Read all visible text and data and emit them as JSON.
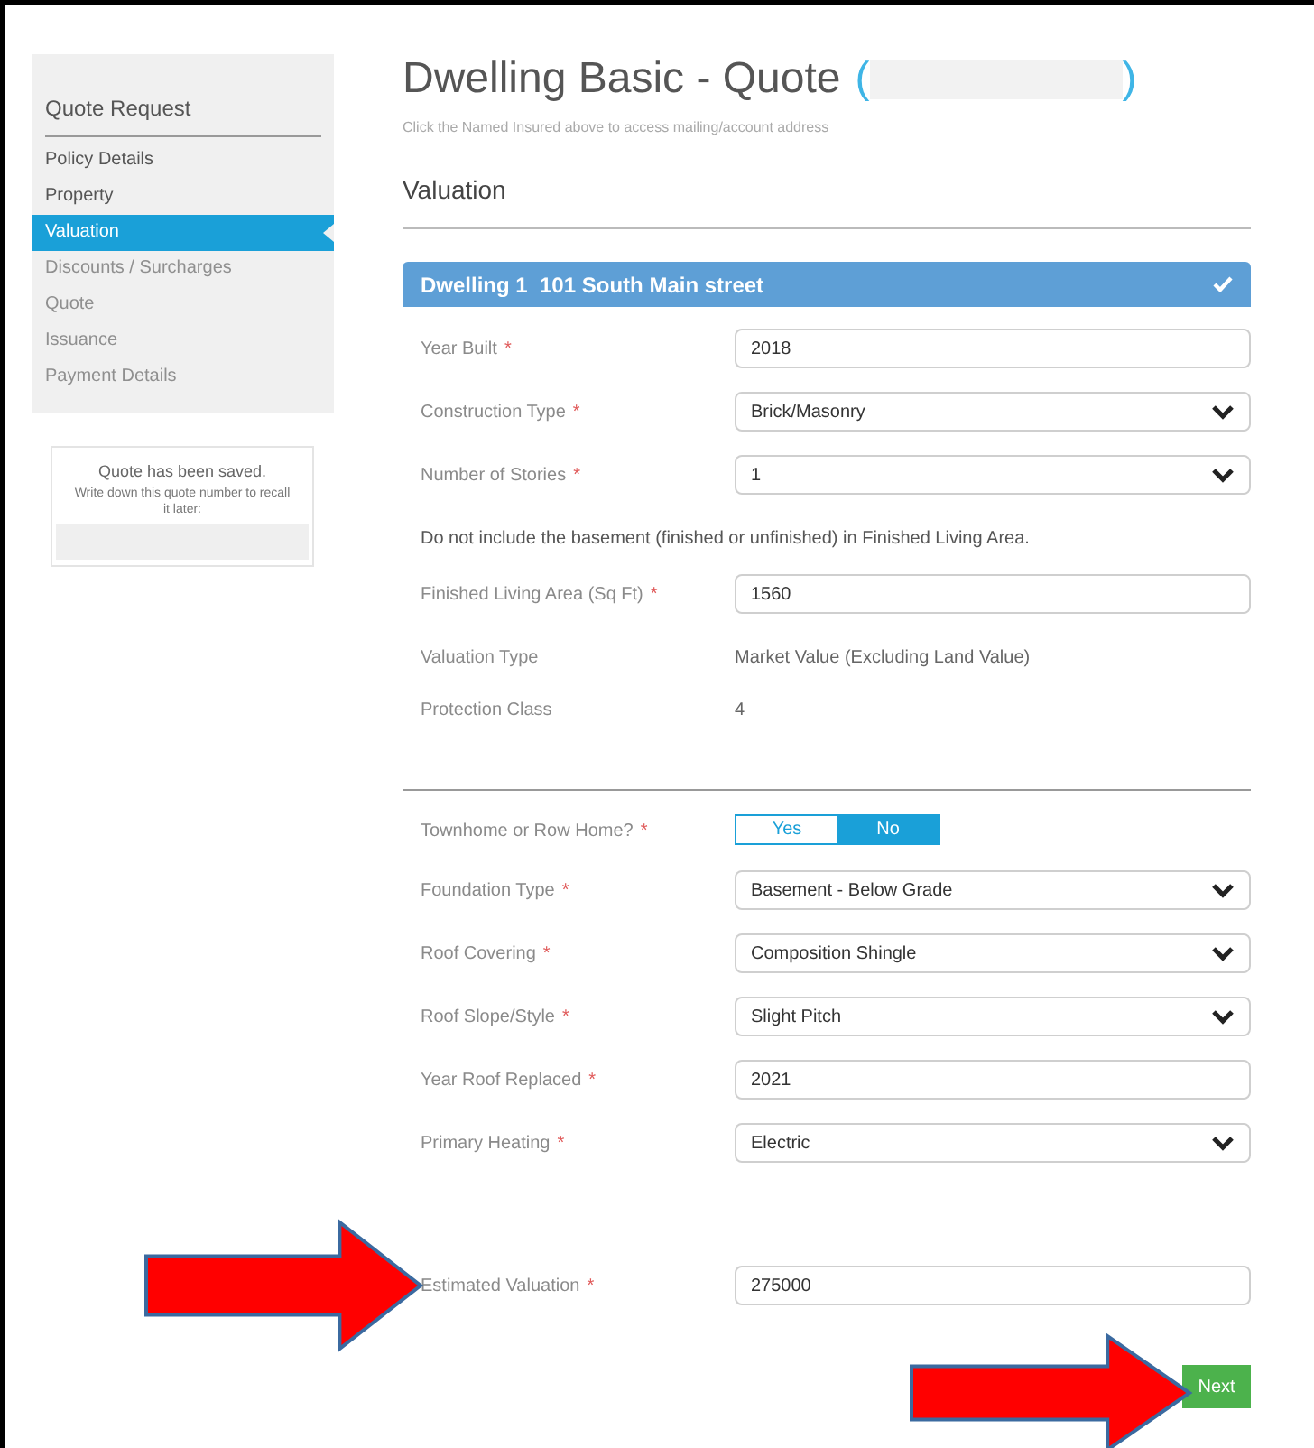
{
  "sidebar": {
    "title": "Quote Request",
    "items": [
      {
        "label": "Policy Details",
        "selected": false,
        "disabled": false
      },
      {
        "label": "Property",
        "selected": false,
        "disabled": false
      },
      {
        "label": "Valuation",
        "selected": true,
        "disabled": false
      },
      {
        "label": "Discounts / Surcharges",
        "selected": false,
        "disabled": true
      },
      {
        "label": "Quote",
        "selected": false,
        "disabled": true
      },
      {
        "label": "Issuance",
        "selected": false,
        "disabled": true
      },
      {
        "label": "Payment Details",
        "selected": false,
        "disabled": true
      }
    ]
  },
  "saved_notice": {
    "title": "Quote has been saved.",
    "text": "Write down this quote number to recall it later:"
  },
  "header": {
    "title": "Dwelling Basic - Quote",
    "insured_open": "(",
    "insured_close": ")",
    "hint": "Click the Named Insured above to access mailing/account address"
  },
  "section_title": "Valuation",
  "panel": {
    "title": "Dwelling 1  101 South Main street",
    "complete": true
  },
  "sections": [
    [
      {
        "kind": "text",
        "label": "Year Built",
        "required_mark": "*",
        "value": "2018"
      },
      {
        "kind": "select",
        "label": "Construction Type",
        "required_mark": "*",
        "value": "Brick/Masonry"
      },
      {
        "kind": "select",
        "label": "Number of Stories",
        "required_mark": "*",
        "value": "1"
      },
      {
        "kind": "note",
        "text": "Do not include the basement (finished or unfinished) in Finished Living Area."
      },
      {
        "kind": "text",
        "label": "Finished Living Area (Sq Ft)",
        "required_mark": "*",
        "value": "1560"
      },
      {
        "kind": "static",
        "label": "Valuation Type",
        "value": "Market Value (Excluding Land Value)"
      },
      {
        "kind": "static",
        "label": "Protection Class",
        "value": "4"
      }
    ],
    [
      {
        "kind": "toggle",
        "label": "Townhome or Row Home?",
        "required_mark": "*",
        "options": [
          {
            "label": "Yes",
            "selected": false
          },
          {
            "label": "No",
            "selected": true
          }
        ]
      },
      {
        "kind": "select",
        "label": "Foundation Type",
        "required_mark": "*",
        "value": "Basement - Below Grade"
      },
      {
        "kind": "select",
        "label": "Roof Covering",
        "required_mark": "*",
        "value": "Composition Shingle"
      },
      {
        "kind": "select",
        "label": "Roof Slope/Style",
        "required_mark": "*",
        "value": "Slight Pitch"
      },
      {
        "kind": "text",
        "label": "Year Roof Replaced",
        "required_mark": "*",
        "value": "2021"
      },
      {
        "kind": "select",
        "label": "Primary Heating",
        "required_mark": "*",
        "value": "Electric"
      }
    ],
    [
      {
        "kind": "text",
        "label": "Estimated Valuation",
        "required_mark": "*",
        "value": "275000"
      }
    ]
  ],
  "next_button": "Next"
}
